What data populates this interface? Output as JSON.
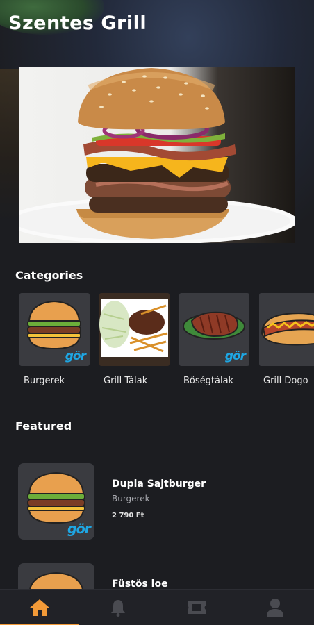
{
  "header": {
    "title": "Szentes Grill"
  },
  "categories": {
    "title": "Categories",
    "items": [
      {
        "label": "Burgerek"
      },
      {
        "label": "Grill Tálak"
      },
      {
        "label": "Bőségtálak"
      },
      {
        "label": "Grill Dogo"
      }
    ]
  },
  "featured": {
    "title": "Featured",
    "items": [
      {
        "name": "Dupla Sajtburger",
        "category": "Burgerek",
        "price": "2 790 Ft"
      },
      {
        "name": "Füstös loe",
        "category": "",
        "price": ""
      }
    ]
  },
  "brand_badge": "gör",
  "tabbar": {
    "tabs": [
      {
        "icon": "home-icon",
        "active": true
      },
      {
        "icon": "bell-icon",
        "active": false
      },
      {
        "icon": "ticket-icon",
        "active": false
      },
      {
        "icon": "user-icon",
        "active": false
      }
    ]
  },
  "colors": {
    "background": "#1c1d21",
    "accent": "#f29a38",
    "badge": "#1ea7e4",
    "tile": "#3a3b40"
  }
}
